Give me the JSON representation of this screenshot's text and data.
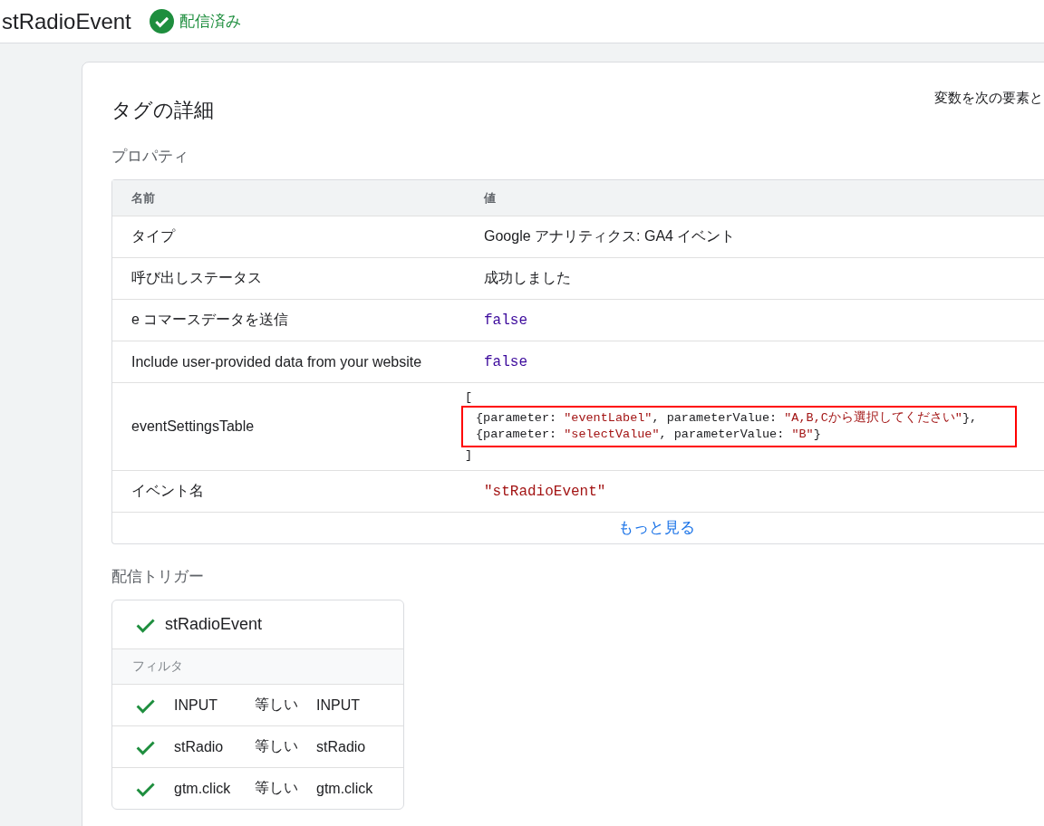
{
  "header": {
    "title": "stRadioEvent",
    "status": {
      "label": "配信済み",
      "kind": "published"
    }
  },
  "card": {
    "title": "タグの詳細",
    "side_text": "変数を次の要素と",
    "properties": {
      "heading": "プロパティ",
      "columns": [
        "名前",
        "値"
      ],
      "rows": [
        {
          "name": "タイプ",
          "kind": "text",
          "value": "Google アナリティクス: GA4 イベント"
        },
        {
          "name": "呼び出しステータス",
          "kind": "text",
          "value": "成功しました"
        },
        {
          "name": "e コマースデータを送信",
          "kind": "boolean",
          "value": "false"
        },
        {
          "name": "Include user-provided data from your website",
          "kind": "boolean",
          "value": "false"
        },
        {
          "name": "eventSettingsTable",
          "kind": "array",
          "open": "[",
          "close": "]",
          "highlighted": true,
          "lines": [
            [
              {
                "kind": "plain",
                "text": "{parameter: "
              },
              {
                "kind": "string",
                "text": "\"eventLabel\""
              },
              {
                "kind": "plain",
                "text": ", parameterValue: "
              },
              {
                "kind": "string",
                "text": "\"A,B,Cから選択してください\""
              },
              {
                "kind": "plain",
                "text": "},"
              }
            ],
            [
              {
                "kind": "plain",
                "text": "{parameter: "
              },
              {
                "kind": "string",
                "text": "\"selectValue\""
              },
              {
                "kind": "plain",
                "text": ", parameterValue: "
              },
              {
                "kind": "string",
                "text": "\"B\""
              },
              {
                "kind": "plain",
                "text": "}"
              }
            ]
          ]
        },
        {
          "name": "イベント名",
          "kind": "string",
          "value": "\"stRadioEvent\""
        }
      ],
      "more_link": "もっと見る"
    },
    "triggers": {
      "heading": "配信トリガー",
      "items": [
        {
          "name": "stRadioEvent",
          "fired": true,
          "filter_heading": "フィルタ",
          "filters": [
            {
              "variable": "INPUT",
              "operator": "等しい",
              "value": "INPUT",
              "passed": true
            },
            {
              "variable": "stRadio",
              "operator": "等しい",
              "value": "stRadio",
              "passed": true
            },
            {
              "variable": "gtm.click",
              "operator": "等しい",
              "value": "gtm.click",
              "passed": true
            }
          ]
        }
      ]
    }
  }
}
